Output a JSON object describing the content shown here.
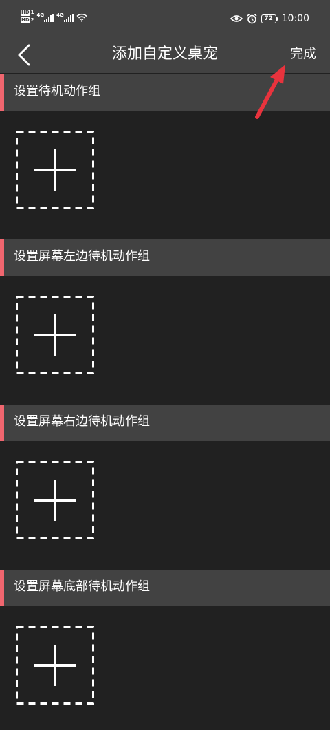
{
  "status_bar": {
    "hd1": "HD",
    "hd1_sub": "1",
    "hd2": "HD",
    "hd2_sub": "2",
    "sim1_net": "4G",
    "sim2_net": "4G",
    "battery": "72",
    "time": "10:00",
    "icons": [
      "wifi-icon",
      "eye-icon",
      "alarm-icon",
      "battery-icon"
    ]
  },
  "header": {
    "title": "添加自定义桌宠",
    "done_label": "完成",
    "back_icon": "chevron-left-icon"
  },
  "sections": [
    {
      "label": "设置待机动作组",
      "slot_icon": "plus-icon"
    },
    {
      "label": "设置屏幕左边待机动作组",
      "slot_icon": "plus-icon"
    },
    {
      "label": "设置屏幕右边待机动作组",
      "slot_icon": "plus-icon"
    },
    {
      "label": "设置屏幕底部待机动作组",
      "slot_icon": "plus-icon"
    }
  ],
  "colors": {
    "background": "#212121",
    "bar": "#424242",
    "accent": "#f0666f",
    "annotation_arrow": "#e8333d",
    "text": "#ffffff"
  }
}
